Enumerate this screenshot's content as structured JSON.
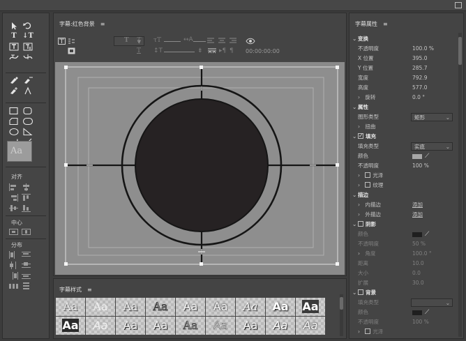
{
  "colors": {
    "canvas_bg": "#8a8a8a",
    "circle_fill": "#262223",
    "fill_swatch": "#a6a6a6",
    "shadow_swatch": "#1f1f1f",
    "bg_swatch": "#1f1f1f"
  },
  "tools": {
    "icons": [
      "selection-tool",
      "rotation-tool",
      "type-tool",
      "vertical-type-tool",
      "area-type-tool",
      "vertical-area-type-tool",
      "path-type-tool",
      "vertical-path-type-tool",
      "pen-tool",
      "delete-anchor-tool",
      "add-anchor-tool",
      "convert-anchor-tool",
      "rectangle-tool",
      "rounded-rectangle-tool",
      "clipped-corner-tool",
      "ellipse-tool",
      "wedge-tool",
      "arc-tool",
      "line-tool"
    ],
    "preview_glyph": "Aa",
    "align_label": "对齐",
    "center_label": "中心",
    "distribute_label": "分布"
  },
  "title_panel": {
    "tab_label": "字幕:红色背景",
    "menu_glyph": "≡",
    "timecode": "00:00:00:00"
  },
  "styles_panel": {
    "tab_label": "字幕样式",
    "menu_glyph": "≡",
    "swatch_text": "Aa",
    "swatches": [
      {
        "style": "font-family:'DejaVu Serif',serif;color:#e8e8e8;text-shadow:1px 1px 0 #555"
      },
      {
        "style": "font-family:'DejaVu Serif',serif;color:#f0f0f0"
      },
      {
        "style": "font-family:'DejaVu Serif',serif;color:#eeeeee;text-shadow:1px 1px 1px #222"
      },
      {
        "style": "font-family:'DejaVu Serif',serif;color:transparent;-webkit-text-stroke:1px #444"
      },
      {
        "style": "font-family:'DejaVu Sans',sans-serif;color:#f4f4f4;text-shadow:1px 1px 1px #333"
      },
      {
        "style": "font-family:'DejaVu Sans',sans-serif;color:#fafafa;text-shadow:0 0 2px #000"
      },
      {
        "style": "font-family:'DejaVu Serif',serif;font-style:italic;color:#f2f2f2;text-shadow:1px 1px 1px #222"
      },
      {
        "style": "font-family:'DejaVu Sans',sans-serif;font-weight:bold;color:#ffffff;text-shadow:1px 1px 2px #000"
      },
      {
        "style": "font-family:'DejaVu Sans',sans-serif;font-weight:bold;color:#ffffff;background:#3a3a3a"
      },
      {
        "style": "font-family:'DejaVu Sans',sans-serif;font-weight:bold;color:#ffffff;background:#2a2a2a"
      },
      {
        "style": "font-family:'DejaVu Sans',sans-serif;font-style:italic;color:#efefef"
      },
      {
        "style": "font-family:'DejaVu Sans',sans-serif;color:#eeeeee;text-shadow:1px 1px 0 #222"
      },
      {
        "style": "font-family:'DejaVu Sans',sans-serif;color:#f4f4f4;text-shadow:1px 1px 1px #111"
      },
      {
        "style": "font-family:'DejaVu Serif',serif;color:transparent;-webkit-text-stroke:1px #555"
      },
      {
        "style": "font-family:'DejaVu Sans',sans-serif;color:#dcdcdc;-webkit-text-stroke:0.5px #555"
      },
      {
        "style": "font-family:'DejaVu Sans',sans-serif;color:#f6f6f6;text-shadow:1px 1px 1px #000"
      },
      {
        "style": "font-family:'DejaVu Sans',sans-serif;font-style:italic;color:#ffffff;text-shadow:1px 1px 1px #222"
      },
      {
        "style": "font-family:'DejaVu Sans',sans-serif;font-style:italic;color:#fafafa;text-shadow:0 0 2px #000"
      }
    ]
  },
  "props": {
    "tab_label": "字幕属性",
    "menu_glyph": "≡",
    "transform": {
      "label": "变换",
      "opacity_label": "不透明度",
      "opacity": "100.0 %",
      "x_label": "X 位置",
      "x": "395.0",
      "y_label": "Y 位置",
      "y": "285.7",
      "width_label": "宽度",
      "width": "792.9",
      "height_label": "高度",
      "height": "577.0",
      "rotation_label": "旋转",
      "rotation": "0.0 °"
    },
    "attributes": {
      "label": "属性",
      "shape_label": "图形类型",
      "shape": "矩形",
      "distort_label": "扭曲"
    },
    "fill": {
      "label": "填充",
      "type_label": "填充类型",
      "type": "实底",
      "color_label": "颜色",
      "opacity_label": "不透明度",
      "opacity": "100 %",
      "sheen_label": "光泽",
      "texture_label": "纹理"
    },
    "stroke": {
      "label": "描边",
      "inner_label": "内描边",
      "inner_add": "添加",
      "outer_label": "外描边",
      "outer_add": "添加"
    },
    "shadow": {
      "label": "阴影",
      "color_label": "颜色",
      "opacity_label": "不透明度",
      "opacity": "50 %",
      "angle_label": "角度",
      "angle": "100.0 °",
      "distance_label": "距离",
      "distance": "10.0",
      "size_label": "大小",
      "size": "0.0",
      "spread_label": "扩展",
      "spread": "30.0"
    },
    "background": {
      "label": "背景",
      "type_label": "填充类型",
      "color_label": "颜色",
      "opacity_label": "不透明度",
      "opacity": "100 %",
      "sheen_label": "光泽"
    }
  }
}
